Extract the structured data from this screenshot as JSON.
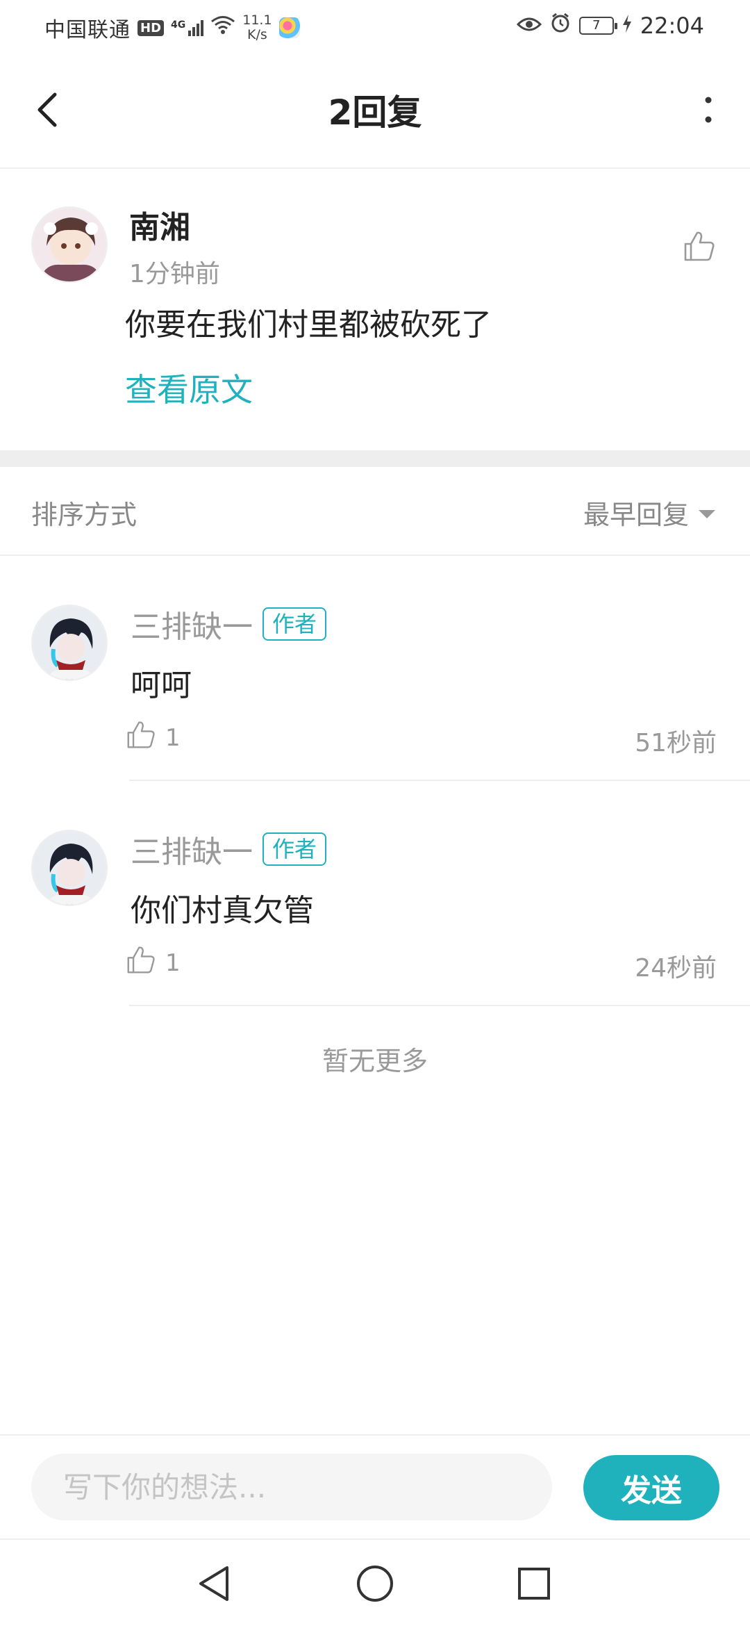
{
  "status_bar": {
    "carrier": "中国联通",
    "hd": "HD",
    "network": "4G",
    "speed_value": "11.1",
    "speed_unit": "K/s",
    "battery": "7",
    "time": "22:04"
  },
  "header": {
    "title": "2回复"
  },
  "original_comment": {
    "author": "南湘",
    "time": "1分钟前",
    "text": "你要在我们村里都被砍死了",
    "view_original_label": "查看原文"
  },
  "sort": {
    "label": "排序方式",
    "selected": "最早回复"
  },
  "replies": [
    {
      "author": "三排缺一",
      "tag": "作者",
      "text": "呵呵",
      "likes": "1",
      "time": "51秒前"
    },
    {
      "author": "三排缺一",
      "tag": "作者",
      "text": "你们村真欠管",
      "likes": "1",
      "time": "24秒前"
    }
  ],
  "footer_text": "暂无更多",
  "input_bar": {
    "placeholder": "写下你的想法...",
    "send_label": "发送"
  },
  "colors": {
    "accent": "#1fb2bd",
    "muted_text": "#999999",
    "divider": "#eeeeee"
  },
  "icons": [
    "back-arrow-icon",
    "more-vertical-icon",
    "thumbs-up-icon",
    "dropdown-triangle-icon",
    "nav-back-icon",
    "nav-home-icon",
    "nav-recents-icon"
  ]
}
